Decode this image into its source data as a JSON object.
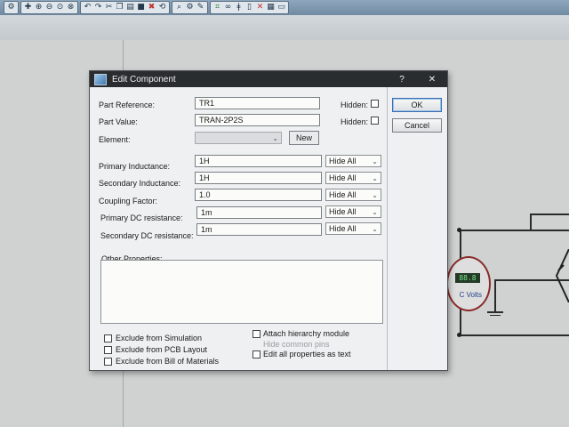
{
  "dialog": {
    "title": "Edit Component",
    "help_glyph": "?",
    "close_glyph": "✕"
  },
  "fields": {
    "part_reference": {
      "label": "Part Reference:",
      "value": "TR1"
    },
    "part_value": {
      "label": "Part Value:",
      "value": "TRAN-2P2S"
    },
    "element": {
      "label": "Element:",
      "value": "",
      "new_label": "New"
    },
    "hidden_label": "Hidden:"
  },
  "properties": [
    {
      "label": "Primary Inductance:",
      "value": "1H",
      "visibility": "Hide All"
    },
    {
      "label": "Secondary Inductance:",
      "value": "1H",
      "visibility": "Hide All"
    },
    {
      "label": "Coupling Factor:",
      "value": "1.0",
      "visibility": "Hide All"
    },
    {
      "label": "Primary DC resistance:",
      "value": "1m",
      "visibility": "Hide All"
    },
    {
      "label": "Secondary DC resistance:",
      "value": "1m",
      "visibility": "Hide All"
    }
  ],
  "other_properties": {
    "label": "Other Properties:"
  },
  "options": {
    "exclude_simulation": {
      "label": "Exclude from Simulation",
      "checked": false
    },
    "exclude_pcb": {
      "label": "Exclude from PCB Layout",
      "checked": false
    },
    "exclude_bom": {
      "label": "Exclude from Bill of Materials",
      "checked": false
    },
    "attach_hierarchy": {
      "label": "Attach hierarchy module",
      "checked": false
    },
    "hide_common_pins": {
      "label": "Hide common pins",
      "checked": false,
      "enabled": false
    },
    "edit_as_text": {
      "label": "Edit all properties as text",
      "checked": false
    }
  },
  "buttons": {
    "ok": "OK",
    "cancel": "Cancel"
  },
  "meter": {
    "reading": "88.8",
    "unit": "C Volts"
  },
  "icons": {
    "dropdown": "chevron-down-icon",
    "app": "component-icon"
  }
}
